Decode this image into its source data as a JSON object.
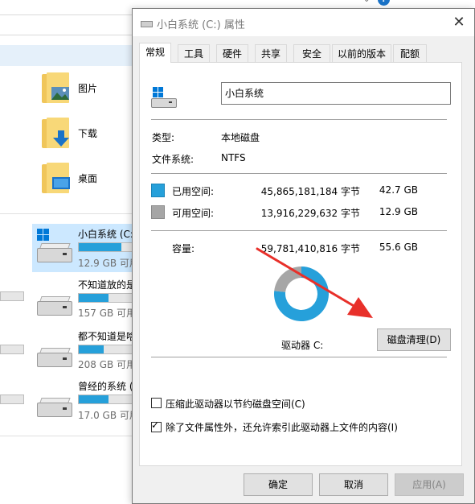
{
  "explorer": {
    "help_glyph": "?",
    "chevron_glyph": "⌄",
    "folders": [
      {
        "label": "图片"
      },
      {
        "label": "下载"
      },
      {
        "label": "桌面"
      }
    ],
    "drives": [
      {
        "name": "小白系统 (C:)",
        "free": "12.9 GB 可用",
        "used_fraction": 0.78
      },
      {
        "name": "不知道放的是",
        "free": "157 GB 可用",
        "used_fraction": 0.55
      },
      {
        "name": "都不知道是啥",
        "free": "208 GB 可用",
        "used_fraction": 0.45
      },
      {
        "name": "曾经的系统 (",
        "free": "17.0 GB 可用",
        "used_fraction": 0.55
      }
    ]
  },
  "dialog": {
    "title": "小白系统 (C:) 属性",
    "close_glyph": "✕",
    "tabs": [
      "常规",
      "工具",
      "硬件",
      "共享",
      "安全",
      "以前的版本",
      "配额"
    ],
    "active_tab": "常规",
    "name_value": "小白系统",
    "type_label": "类型:",
    "type_value": "本地磁盘",
    "fs_label": "文件系统:",
    "fs_value": "NTFS",
    "used": {
      "label": "已用空间:",
      "bytes": "45,865,181,184 字节",
      "size": "42.7 GB",
      "color": "#26a0da"
    },
    "free": {
      "label": "可用空间:",
      "bytes": "13,916,229,632 字节",
      "size": "12.9 GB",
      "color": "#a6a6a6"
    },
    "capacity": {
      "label": "容量:",
      "bytes": "59,781,410,816 字节",
      "size": "55.6 GB"
    },
    "used_fraction": 0.767,
    "drive_label": "驱动器 C:",
    "cleanup_button": "磁盘清理(D)",
    "compress_label": "压缩此驱动器以节约磁盘空间(C)",
    "compress_checked": false,
    "index_label": "除了文件属性外，还允许索引此驱动器上文件的内容(I)",
    "index_checked": true,
    "check_glyph": "✓",
    "ok_button": "确定",
    "cancel_button": "取消",
    "apply_button": "应用(A)",
    "arrow_color": "#e8302a"
  }
}
